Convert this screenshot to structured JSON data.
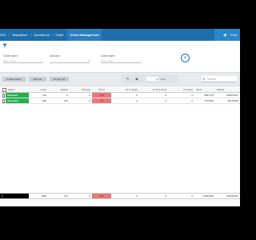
{
  "breadcrumb": [
    "DS1",
    "Dispatcher",
    "Operations",
    "Order",
    "Order Management"
  ],
  "topbar": {
    "action_label": "Post"
  },
  "filters": {
    "fields": [
      {
        "label": "Outlet Name",
        "placeholder": "Enter value"
      },
      {
        "label": "Operator",
        "placeholder": ""
      },
      {
        "label": "Outlet Name",
        "placeholder": "Enter value"
      }
    ]
  },
  "toolbar": {
    "buttons": [
      "Update Status",
      "Allocate",
      "Merge Sub"
    ],
    "player_value": "0",
    "player_unit": "mins",
    "search_placeholder": "Search"
  },
  "table": {
    "headers": [
      "Status",
      "Lines",
      "Tasked",
      "Shipped",
      "Short",
      "Ni to Stage",
      "At Ship Dock",
      "At Trailer",
      "Value",
      "Weight"
    ],
    "rows": [
      {
        "status": "Released",
        "lines": "720",
        "tasked": "0",
        "shipped": "0",
        "short": "776",
        "ni_to_stage": "0",
        "at_ship_dock": "0",
        "at_trailer": "0",
        "value": "9867778",
        "weight": "198874407"
      },
      {
        "status": "Allocated",
        "lines": "286",
        "tasked": "272",
        "shipped": "0",
        "short": "28",
        "ni_to_stage": "0",
        "at_ship_dock": "0",
        "at_trailer": "0",
        "value": "7575483",
        "weight": "98715083"
      }
    ],
    "totals": {
      "status": "2",
      "lines": "1006",
      "tasked": "272",
      "shipped": "0",
      "short": "804",
      "ni_to_stage": "0",
      "at_ship_dock": "0",
      "at_trailer": "0",
      "value": "24932199",
      "weight": "234154407"
    }
  },
  "colors": {
    "topbar": "#1f6fad",
    "status_green": "#22b14c",
    "short_red": "#e8787a"
  }
}
